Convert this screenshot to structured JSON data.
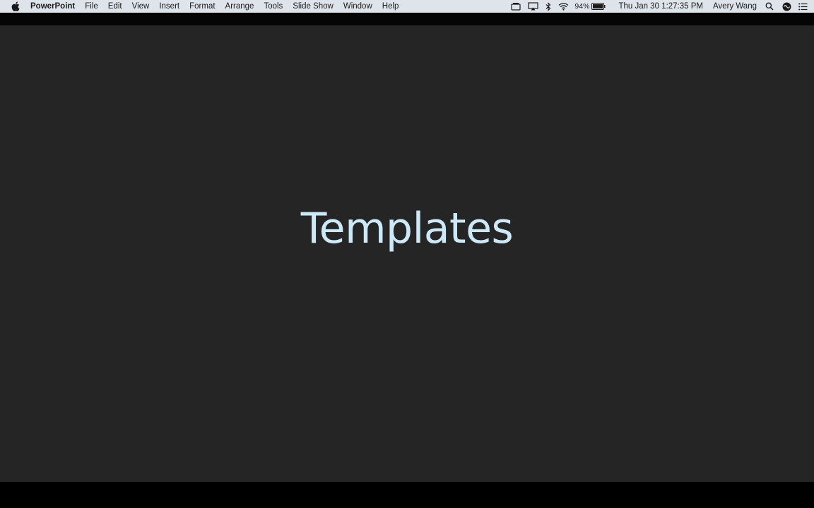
{
  "menubar": {
    "app_name": "PowerPoint",
    "menus": [
      "File",
      "Edit",
      "View",
      "Insert",
      "Format",
      "Arrange",
      "Tools",
      "Slide Show",
      "Window",
      "Help"
    ],
    "status_icons": [
      "screen-mirror-icon",
      "airplay-icon",
      "bluetooth-icon",
      "wifi-icon"
    ],
    "battery_percent": "94%",
    "clock": "Thu Jan 30  1:27:35 PM",
    "user": "Avery Wang"
  },
  "slide": {
    "title": "Templates",
    "background_color": "#252525",
    "title_color": "#cde8f6"
  }
}
